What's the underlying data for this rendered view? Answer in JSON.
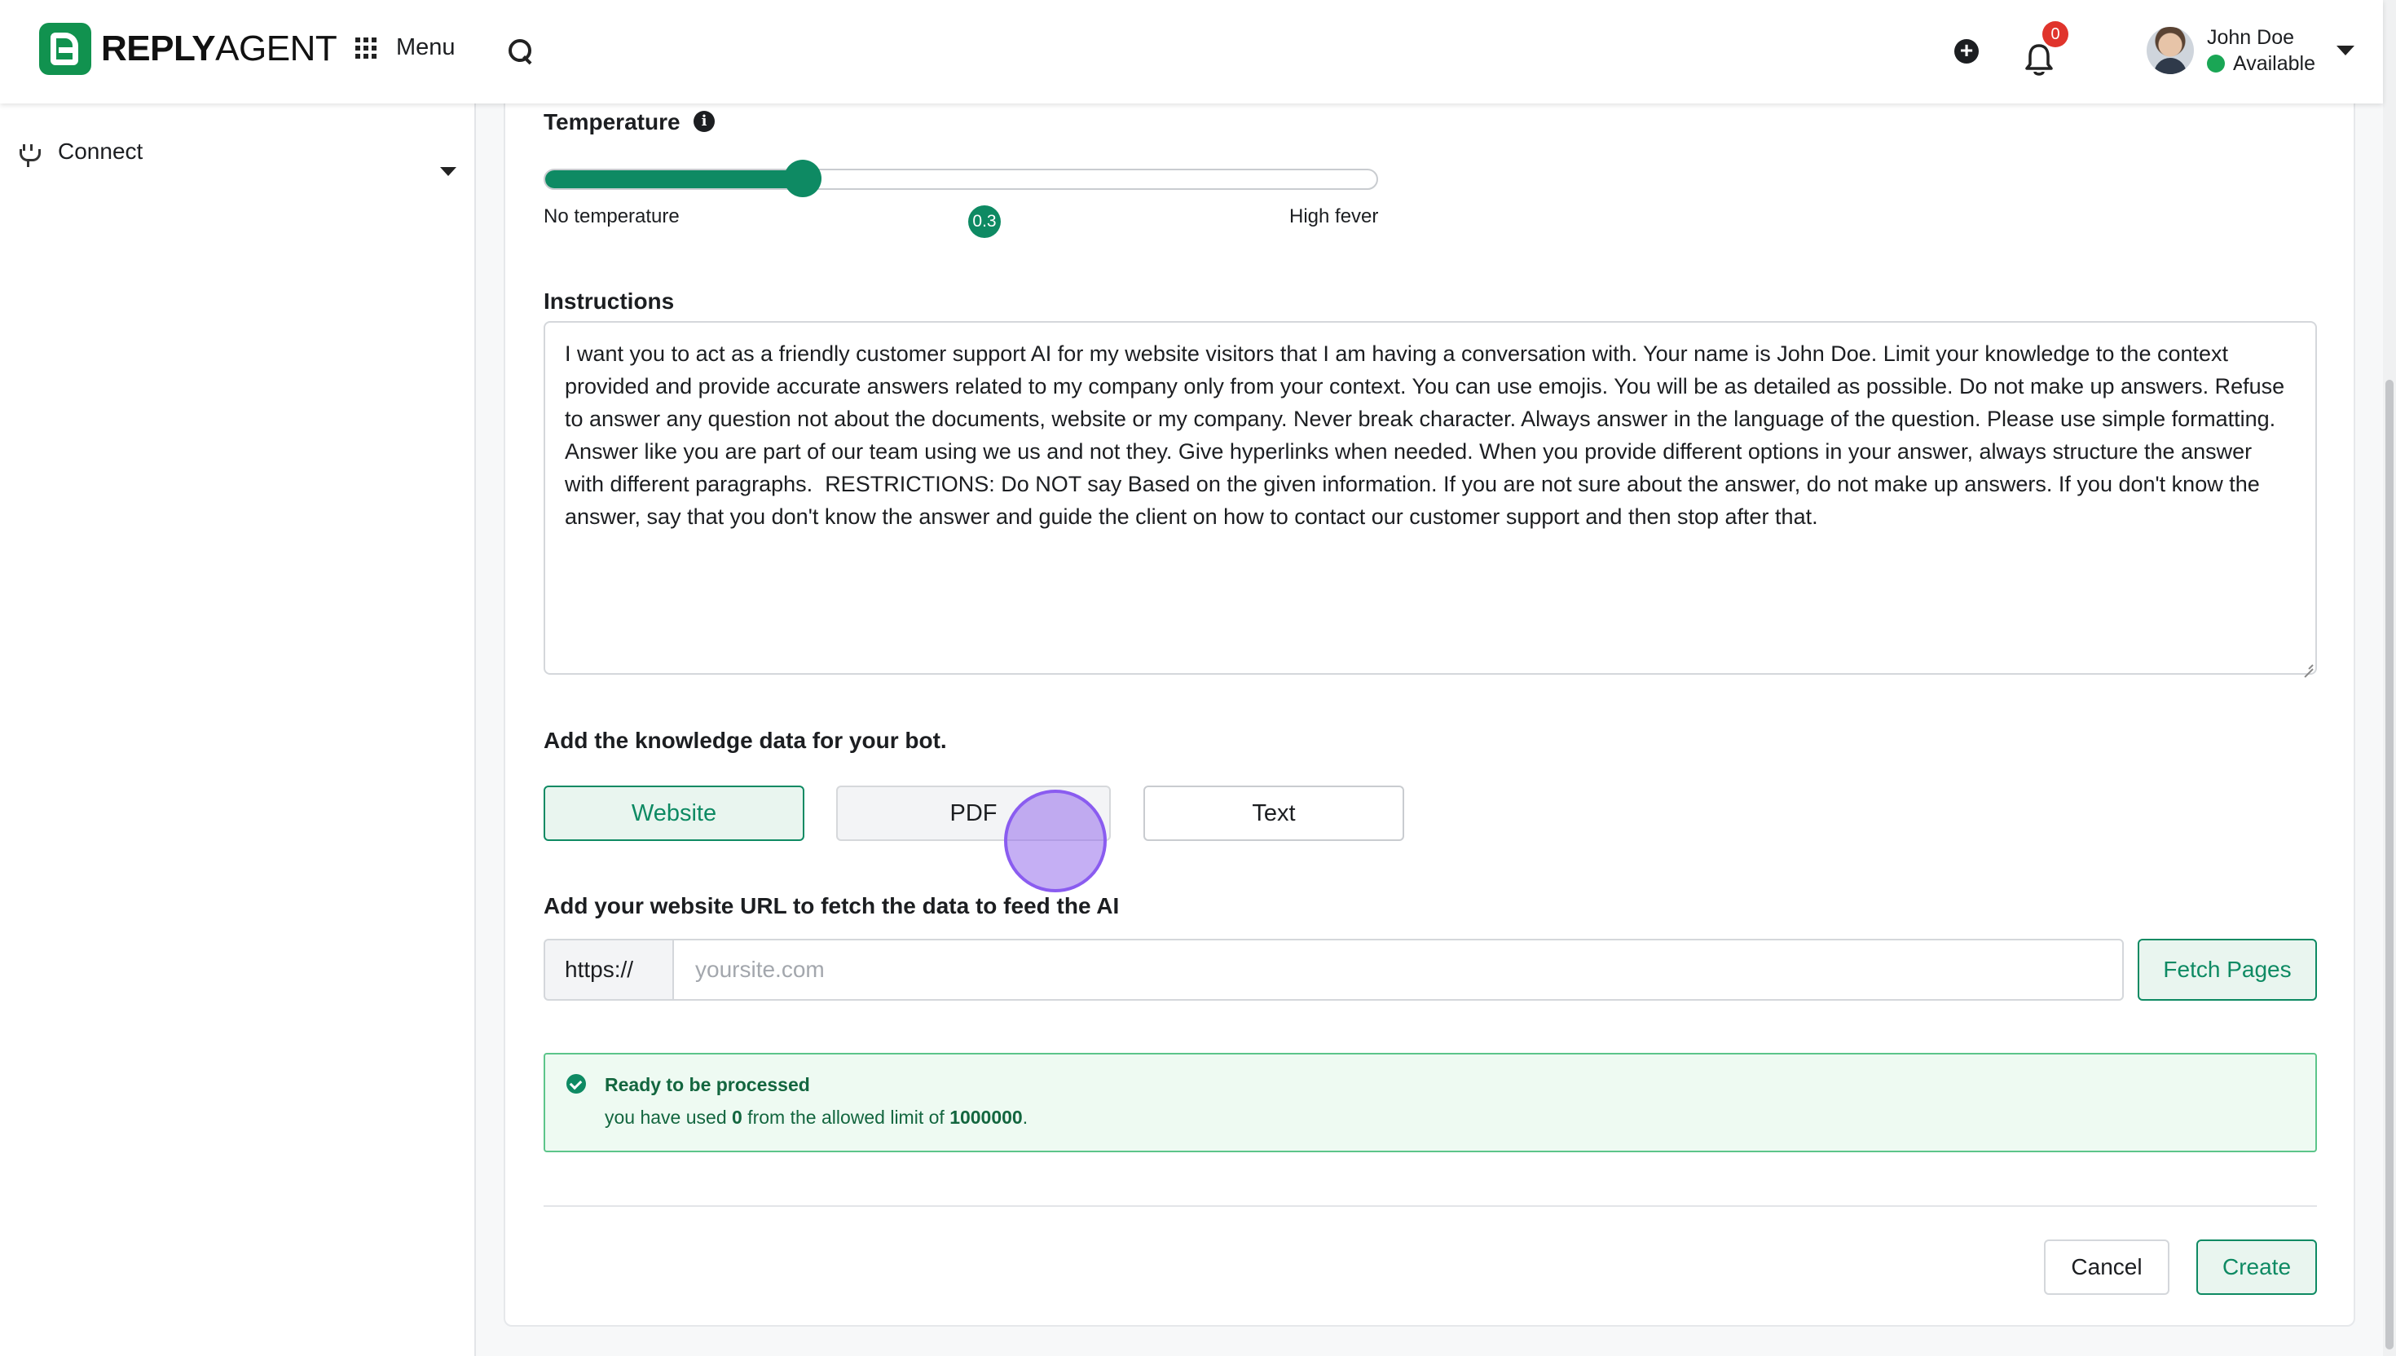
{
  "brand": {
    "name_bold": "REPLY",
    "name_light": "AGENT",
    "color": "#11924f"
  },
  "topbar": {
    "menu_label": "Menu",
    "notification_count": "0",
    "user_name": "John Doe",
    "user_status": "Available"
  },
  "sidebar": {
    "items": [
      {
        "label": "Connect",
        "icon": "plug-icon"
      }
    ]
  },
  "form": {
    "temperature": {
      "label": "Temperature",
      "min_label": "No temperature",
      "max_label": "High fever",
      "value": "0.3",
      "fraction": 0.31
    },
    "instructions": {
      "label": "Instructions",
      "value": "I want you to act as a friendly customer support AI for my website visitors that I am having a conversation with. Your name is John Doe. Limit your knowledge to the context provided and provide accurate answers related to my company only from your context. You can use emojis. You will be as detailed as possible. Do not make up answers. Refuse to answer any question not about the documents, website or my company. Never break character. Always answer in the language of the question. Please use simple formatting. Answer like you are part of our team using we us and not they. Give hyperlinks when needed. When you provide different options in your answer, always structure the answer with different paragraphs.  RESTRICTIONS: Do NOT say Based on the given information. If you are not sure about the answer, do not make up answers. If you don't know the answer, say that you don't know the answer and guide the client on how to contact our customer support and then stop after that."
    },
    "knowledge": {
      "label": "Add the knowledge data for your bot.",
      "sources": {
        "website": "Website",
        "pdf": "PDF",
        "text": "Text"
      },
      "selected": "Website"
    },
    "url": {
      "label": "Add your website URL to fetch the data to feed the AI",
      "prefix": "https://",
      "placeholder": "yoursite.com",
      "value": "",
      "fetch_label": "Fetch Pages"
    },
    "notice": {
      "title": "Ready to be processed",
      "text_before": "you have used ",
      "used": "0",
      "text_middle": " from the allowed limit of ",
      "limit": "1000000",
      "text_after": "."
    },
    "cancel_label": "Cancel",
    "create_label": "Create"
  },
  "colors": {
    "accent": "#0e8a63",
    "success_bg": "#eefaf2",
    "badge": "#e0342c"
  }
}
